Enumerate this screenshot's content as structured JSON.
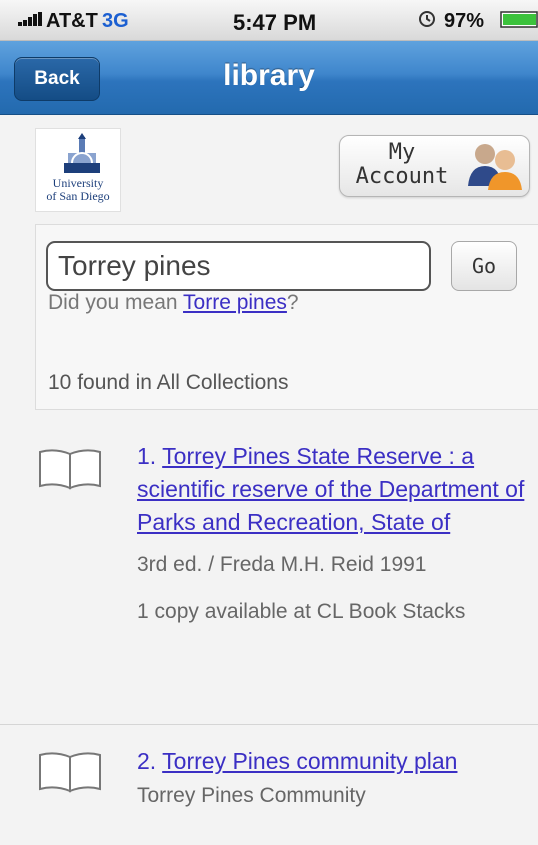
{
  "status_bar": {
    "carrier": "AT&T",
    "network": "3G",
    "time": "5:47 PM",
    "battery": "97%"
  },
  "nav": {
    "back_label": "Back",
    "title": "library"
  },
  "header": {
    "logo_line1": "University",
    "logo_line2": "of San Diego",
    "account_line1": "My",
    "account_line2": "Account"
  },
  "search": {
    "value": "Torrey pines",
    "go_label": "Go",
    "suggestion_prefix": "Did you mean ",
    "suggestion_link": "Torre pines",
    "suggestion_suffix": "?",
    "result_count": "10 found in All Collections"
  },
  "results": [
    {
      "number": "1.",
      "title": "Torrey Pines State Reserve : a scientific reserve of the Department of Parks and Recreation, State of",
      "meta": "3rd ed. / Freda M.H. Reid 1991",
      "availability": "1 copy available at CL Book Stacks"
    },
    {
      "number": "2.",
      "title": "Torrey Pines community plan",
      "meta": "Torrey Pines Community"
    }
  ],
  "colors": {
    "nav_blue": "#3f86cc",
    "link": "#3b2fc4",
    "network": "#1b5fd1",
    "battery_green": "#3cc23c"
  },
  "icons": {
    "signal": "signal-bars-icon",
    "alarm": "alarm-clock-icon",
    "battery": "battery-icon",
    "logo": "university-seal-icon",
    "account": "people-icon",
    "book": "open-book-icon"
  }
}
